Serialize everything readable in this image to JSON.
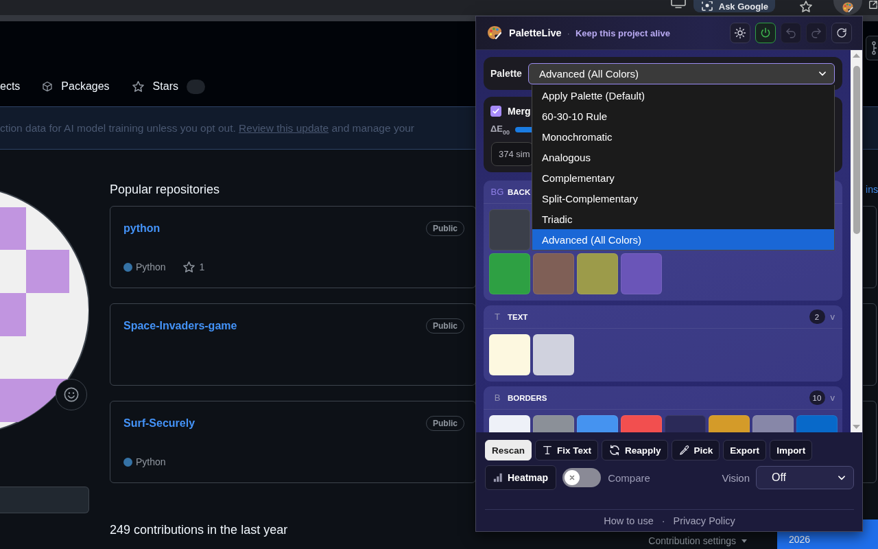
{
  "browser_toolbar": {
    "ask_google": "Ask Google"
  },
  "profile_nav": {
    "tabs": [
      {
        "label": "ects",
        "selected": false
      },
      {
        "label": "Packages",
        "selected": false
      },
      {
        "label": "Stars",
        "selected": false
      }
    ]
  },
  "notice_banner": {
    "text": "ction data for AI model training unless you opt out.",
    "link": "Review this update",
    "text_after": "and manage your"
  },
  "popular_repositories": {
    "title": "Popular repositories",
    "customize_link": "ins",
    "repos": [
      {
        "name": "python",
        "visibility": "Public",
        "language": {
          "name": "Python",
          "color": "#3572a5"
        },
        "star_count": "1"
      },
      {
        "name": "Space-Invaders-game",
        "visibility": "Public"
      },
      {
        "name": "Surf-Securely",
        "visibility": "Public",
        "language": {
          "name": "Python",
          "color": "#3572a5"
        }
      }
    ]
  },
  "contributions": {
    "title": "249 contributions in the last year",
    "settings": "Contribution settings",
    "years": [
      {
        "label": "2026",
        "selected": true
      }
    ]
  },
  "extension_popup": {
    "brand": "PaletteLive",
    "separator": "·",
    "tagline": "Keep this project alive",
    "header_buttons": [
      {
        "kind": "theme",
        "active": false,
        "disabled": false
      },
      {
        "kind": "power",
        "active": true,
        "disabled": false
      },
      {
        "kind": "undo",
        "active": false,
        "disabled": true
      },
      {
        "kind": "redo",
        "active": false,
        "disabled": true
      },
      {
        "kind": "reload",
        "active": false,
        "disabled": false
      }
    ],
    "palette": {
      "label": "Palette",
      "value": "Advanced (All Colors)",
      "expanded": true,
      "options": [
        {
          "label": "Apply Palette (Default)",
          "selected": false
        },
        {
          "label": "60-30-10 Rule",
          "selected": false
        },
        {
          "label": "Monochromatic",
          "selected": false
        },
        {
          "label": "Analogous",
          "selected": false
        },
        {
          "label": "Complementary",
          "selected": false
        },
        {
          "label": "Split-Complementary",
          "selected": false
        },
        {
          "label": "Triadic",
          "selected": false
        },
        {
          "label": "Advanced (All Colors)",
          "selected": true
        }
      ]
    },
    "merge": {
      "checked": true,
      "label": "Merg",
      "delta_label": "ΔE$_{00}$",
      "summary": "374 sim"
    },
    "sections": [
      {
        "tag": {
          "text": "BG",
          "color": "#8f80e8"
        },
        "title": "BACK",
        "rows": [
          {
            "swatches": [
              {
                "color": "#3b3f4a"
              }
            ]
          },
          {
            "swatches": [
              {
                "color": "#2ea043"
              },
              {
                "color": "#7f5f56"
              },
              {
                "color": "#9c9b4a"
              },
              {
                "color": "#6a55b8"
              }
            ]
          }
        ]
      },
      {
        "tag": {
          "text": "T",
          "color": "#9494b4"
        },
        "title": "TEXT",
        "count": "2",
        "toggle": "v",
        "rows": [
          {
            "swatches": [
              {
                "color": "#fdf8e0"
              },
              {
                "color": "#d0d2de"
              }
            ]
          }
        ]
      },
      {
        "tag": {
          "text": "B",
          "color": "#9494b4"
        },
        "title": "BORDERS",
        "count": "10",
        "toggle": "v",
        "rows": [
          {
            "swatches": [
              {
                "color": "#eef1f8"
              },
              {
                "color": "#8b9098"
              },
              {
                "color": "#4593f0"
              },
              {
                "color": "#f24f4f"
              },
              {
                "color": "#2b2a58"
              },
              {
                "color": "#d49b29"
              },
              {
                "color": "#8787a8"
              },
              {
                "color": "#0869c9"
              }
            ]
          }
        ]
      }
    ],
    "actions": [
      {
        "label": "Rescan",
        "kind": "primary"
      },
      {
        "label": "Fix Text",
        "kind": "fixtext"
      },
      {
        "label": "Reapply",
        "kind": "reapply"
      },
      {
        "label": "Pick",
        "kind": "pick"
      },
      {
        "label": "Export",
        "kind": "plain"
      },
      {
        "label": "Import",
        "kind": "plain"
      }
    ],
    "heatmap": {
      "label": "Heatmap",
      "active": false
    },
    "compare": {
      "label": "Compare",
      "on": false
    },
    "vision": {
      "label": "Vision",
      "value": "Off"
    },
    "footer": {
      "links": [
        "How to use",
        "Privacy Policy"
      ],
      "separator": "·"
    }
  }
}
